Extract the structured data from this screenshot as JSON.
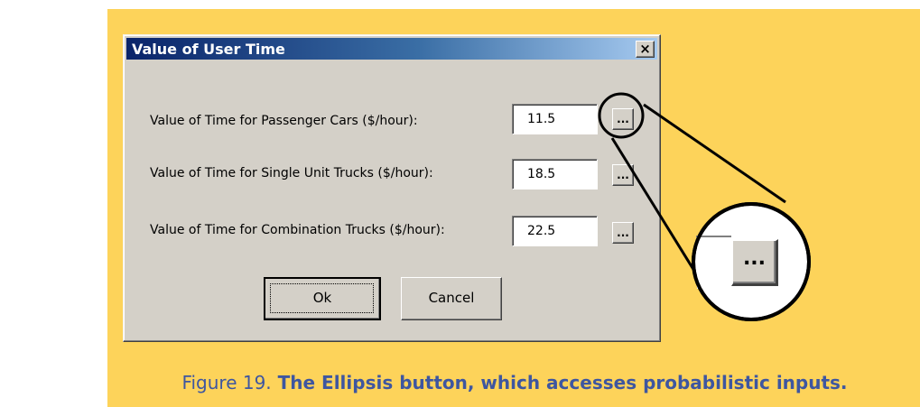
{
  "dialog": {
    "title": "Value of User Time",
    "close_label": "×",
    "rows": [
      {
        "label": "Value of Time for Passenger Cars ($/hour):",
        "value": "11.5",
        "button_label": "..."
      },
      {
        "label": "Value of Time for Single Unit Trucks ($/hour):",
        "value": "18.5",
        "button_label": "..."
      },
      {
        "label": "Value of Time for Combination Trucks ($/hour):",
        "value": "22.5",
        "button_label": "..."
      }
    ],
    "ok_label": "Ok",
    "cancel_label": "Cancel"
  },
  "zoom": {
    "button_label": "..."
  },
  "caption": {
    "prefix": "Figure 19.",
    "text": " The Ellipsis button, which accesses probabilistic inputs."
  },
  "colors": {
    "background": "#fdd35a",
    "dialog_face": "#d4d0c8",
    "titlebar": "#0a246a",
    "caption": "#3e56a0"
  },
  "icons": {
    "close": "close-icon"
  }
}
